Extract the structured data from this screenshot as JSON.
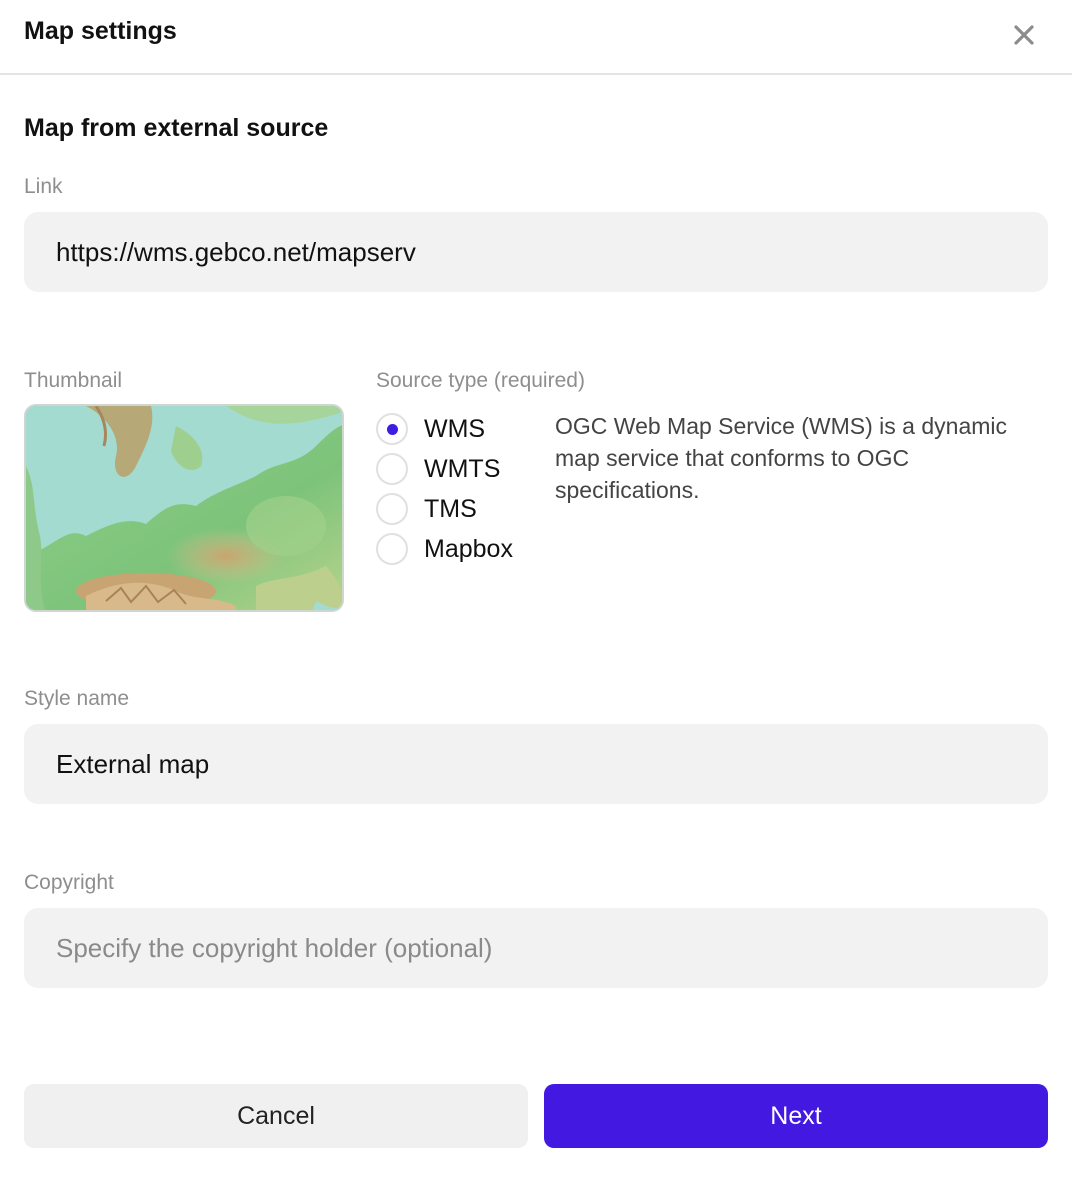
{
  "dialog": {
    "title": "Map settings",
    "close_icon": "close-icon"
  },
  "section_title": "Map from external source",
  "link": {
    "label": "Link",
    "value": "https://wms.gebco.net/mapserv"
  },
  "thumbnail": {
    "label": "Thumbnail"
  },
  "source_type": {
    "label": "Source type (required)",
    "options": [
      "WMS",
      "WMTS",
      "TMS",
      "Mapbox"
    ],
    "selected": "WMS",
    "description": "OGC Web Map Service (WMS) is a dynamic map service that conforms to OGC specifications."
  },
  "style_name": {
    "label": "Style name",
    "value": "External map"
  },
  "copyright": {
    "label": "Copyright",
    "placeholder": "Specify the copyright holder (optional)"
  },
  "buttons": {
    "cancel": "Cancel",
    "next": "Next"
  },
  "colors": {
    "accent": "#4318e0",
    "radio_dot": "#3b1ee0"
  }
}
